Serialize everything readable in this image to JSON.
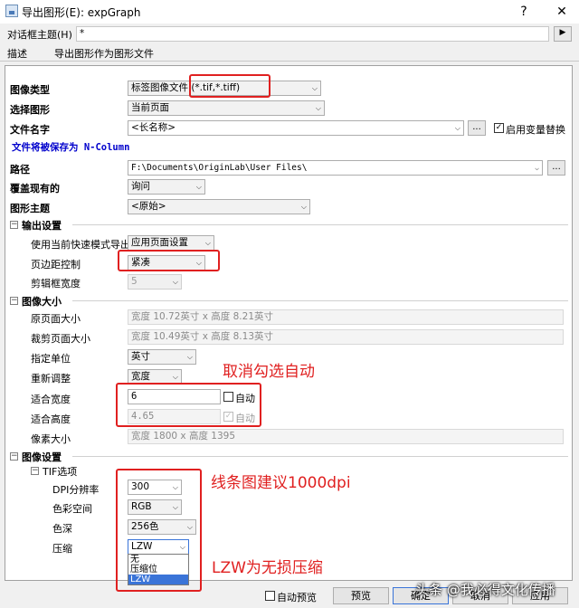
{
  "window": {
    "title": "导出图形(E): expGraph",
    "help": "?",
    "close": "✕"
  },
  "theme": {
    "label": "对话框主题(H)",
    "value": "*"
  },
  "description": {
    "label": "描述",
    "value": "导出图形作为图形文件"
  },
  "form": {
    "image_type": {
      "label": "图像类型",
      "value": "标签图像文件 (*.tif,*.tiff)"
    },
    "select_graph": {
      "label": "选择图形",
      "value": "当前页面"
    },
    "file_name": {
      "label": "文件名字",
      "value": "<长名称>",
      "browse": "...",
      "var_replace_label": "启用变量替换"
    },
    "save_as_note": "文件将被保存为 N-Column",
    "path": {
      "label": "路径",
      "value": "F:\\Documents\\OriginLab\\User Files\\",
      "browse": "..."
    },
    "overwrite": {
      "label": "覆盖现有的",
      "value": "询问"
    },
    "graph_theme": {
      "label": "图形主题",
      "value": "<原始>"
    }
  },
  "output_settings": {
    "header": "输出设置",
    "quick_mode": {
      "label": "使用当前快速模式导出",
      "value": "应用页面设置"
    },
    "margin": {
      "label": "页边距控制",
      "value": "紧凑"
    },
    "clip_width": {
      "label": "剪辑框宽度",
      "value": "5"
    }
  },
  "image_size": {
    "header": "图像大小",
    "orig_page": {
      "label": "原页面大小",
      "value": "宽度 10.72英寸 x 高度 8.21英寸"
    },
    "crop_page": {
      "label": "裁剪页面大小",
      "value": "宽度 10.49英寸 x 高度 8.13英寸"
    },
    "unit": {
      "label": "指定单位",
      "value": "英寸"
    },
    "rescale": {
      "label": "重新调整",
      "value": "宽度"
    },
    "fit_width": {
      "label": "适合宽度",
      "value": "6",
      "auto": "自动"
    },
    "fit_height": {
      "label": "适合高度",
      "value": "4.65",
      "auto": "自动"
    },
    "pixel_size": {
      "label": "像素大小",
      "value": "宽度 1800 x 高度 1395"
    }
  },
  "image_settings": {
    "header": "图像设置",
    "tif_header": "TIF选项",
    "dpi": {
      "label": "DPI分辨率",
      "value": "300"
    },
    "color_space": {
      "label": "色彩空间",
      "value": "RGB"
    },
    "color_depth": {
      "label": "色深",
      "value": "256色"
    },
    "compression": {
      "label": "压缩",
      "value": "LZW",
      "options": [
        "无",
        "压缩位",
        "LZW"
      ]
    }
  },
  "annotations": {
    "uncheck_auto": "取消勾选自动",
    "line_dpi": "线条图建议1000dpi",
    "lzw_note": "LZW为无损压缩"
  },
  "footer": {
    "auto_preview": "自动预览",
    "preview": "预览",
    "ok": "确定",
    "cancel": "取消",
    "apply": "应用"
  },
  "watermark": "头条 @我必得文化传播",
  "colors": {
    "annotation_red": "#e02020",
    "note_blue": "#0000cc",
    "selection_blue": "#3a74d8"
  }
}
